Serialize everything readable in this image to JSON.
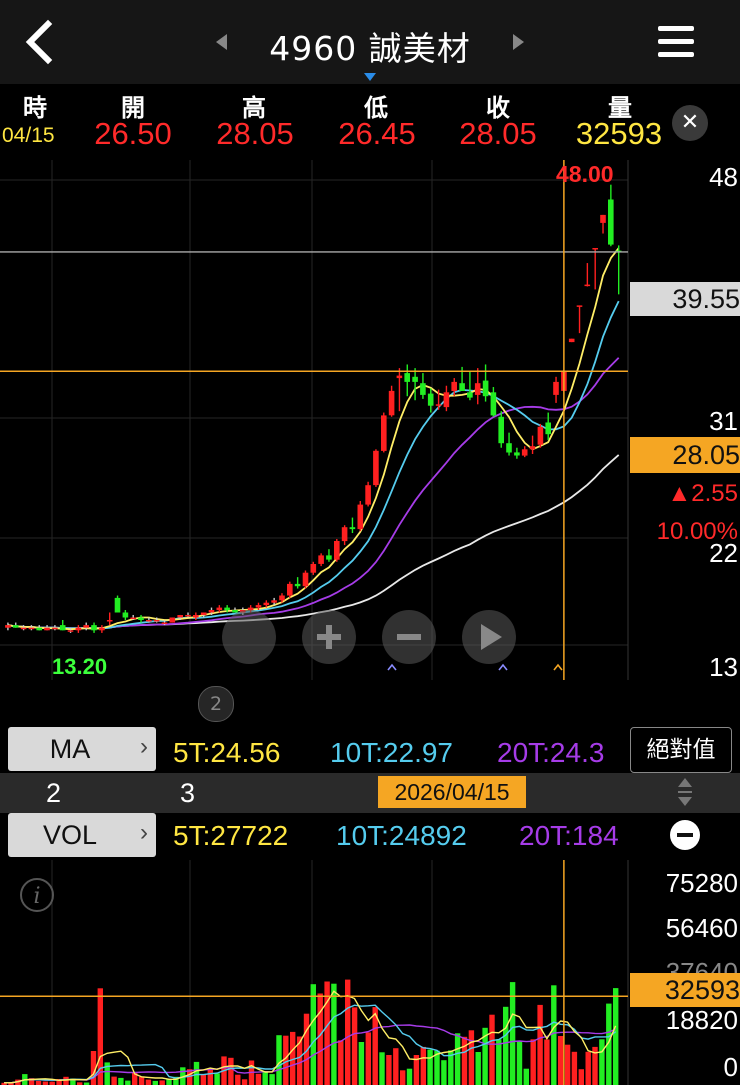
{
  "header": {
    "title": "4960 誠美材"
  },
  "quote": {
    "labels": [
      "時",
      "開",
      "高",
      "低",
      "收",
      "量"
    ],
    "date": "04/15",
    "open": "26.50",
    "high": "28.05",
    "low": "26.45",
    "close": "28.05",
    "volume": "32593"
  },
  "price_axis": {
    "labels": [
      "48",
      "31",
      "22",
      "13"
    ],
    "last_price": "39.55",
    "crosshair_price": "28.05",
    "change": "▲2.55",
    "change_pct": "10.00%",
    "max": "48.00",
    "min": "13.20"
  },
  "page_badge": "2",
  "ma_bar": {
    "button": "MA",
    "ma5": "5T:24.56",
    "ma10": "10T:22.97",
    "ma20": "20T:24.3",
    "abs_button": "絕對值"
  },
  "axis_bar": {
    "left_nums": [
      "2",
      "3"
    ],
    "date": "2026/04/15"
  },
  "vol_bar": {
    "button": "VOL",
    "v5": "5T:27722",
    "v10": "10T:24892",
    "v20": "20T:184"
  },
  "vol_axis": {
    "labels": [
      "75280",
      "56460",
      "37640",
      "18820",
      "0"
    ],
    "crosshair_vol": "32593"
  },
  "colors": {
    "up": "#ff2020",
    "down": "#22ee22",
    "ma5": "#ffee66",
    "ma10": "#55ccee",
    "ma20": "#a63ce8",
    "ma60": "#e8e8e8",
    "crosshair": "#f5a623"
  },
  "chart_data": {
    "type": "candlestick",
    "yscale": "log",
    "ylim": [
      12.0,
      49.5
    ],
    "candles": [
      {
        "o": 13.4,
        "h": 13.6,
        "l": 13.3,
        "c": 13.5
      },
      {
        "o": 13.5,
        "h": 13.6,
        "l": 13.4,
        "c": 13.4
      },
      {
        "o": 13.4,
        "h": 13.5,
        "l": 13.3,
        "c": 13.4
      },
      {
        "o": 13.4,
        "h": 13.5,
        "l": 13.3,
        "c": 13.4
      },
      {
        "o": 13.4,
        "h": 13.5,
        "l": 13.3,
        "c": 13.3
      },
      {
        "o": 13.3,
        "h": 13.5,
        "l": 13.3,
        "c": 13.4
      },
      {
        "o": 13.4,
        "h": 13.5,
        "l": 13.3,
        "c": 13.4
      },
      {
        "o": 13.5,
        "h": 13.7,
        "l": 13.3,
        "c": 13.3
      },
      {
        "o": 13.3,
        "h": 13.4,
        "l": 13.2,
        "c": 13.3
      },
      {
        "o": 13.3,
        "h": 13.5,
        "l": 13.2,
        "c": 13.4
      },
      {
        "o": 13.4,
        "h": 13.6,
        "l": 13.3,
        "c": 13.5
      },
      {
        "o": 13.5,
        "h": 13.6,
        "l": 13.2,
        "c": 13.3
      },
      {
        "o": 13.3,
        "h": 13.5,
        "l": 13.2,
        "c": 13.4
      },
      {
        "o": 13.7,
        "h": 14.0,
        "l": 13.5,
        "c": 13.7
      },
      {
        "o": 14.6,
        "h": 14.7,
        "l": 14.0,
        "c": 14.0
      },
      {
        "o": 14.0,
        "h": 14.1,
        "l": 13.7,
        "c": 13.8
      },
      {
        "o": 13.8,
        "h": 13.9,
        "l": 13.7,
        "c": 13.8
      },
      {
        "o": 13.8,
        "h": 13.9,
        "l": 13.6,
        "c": 13.7
      },
      {
        "o": 13.7,
        "h": 13.8,
        "l": 13.6,
        "c": 13.7
      },
      {
        "o": 13.7,
        "h": 13.8,
        "l": 13.6,
        "c": 13.7
      },
      {
        "o": 13.6,
        "h": 13.7,
        "l": 13.5,
        "c": 13.6
      },
      {
        "o": 13.6,
        "h": 13.8,
        "l": 13.6,
        "c": 13.8
      },
      {
        "o": 13.8,
        "h": 13.9,
        "l": 13.7,
        "c": 13.9
      },
      {
        "o": 13.9,
        "h": 14.0,
        "l": 13.8,
        "c": 13.9
      },
      {
        "o": 13.8,
        "h": 14.0,
        "l": 13.7,
        "c": 13.9
      },
      {
        "o": 13.9,
        "h": 14.0,
        "l": 13.8,
        "c": 14.0
      },
      {
        "o": 14.0,
        "h": 14.2,
        "l": 13.9,
        "c": 14.1
      },
      {
        "o": 14.1,
        "h": 14.3,
        "l": 14.0,
        "c": 14.2
      },
      {
        "o": 14.2,
        "h": 14.3,
        "l": 14.0,
        "c": 14.1
      },
      {
        "o": 14.1,
        "h": 14.2,
        "l": 14.0,
        "c": 14.0
      },
      {
        "o": 14.0,
        "h": 14.2,
        "l": 13.9,
        "c": 14.1
      },
      {
        "o": 14.1,
        "h": 14.3,
        "l": 14.0,
        "c": 14.2
      },
      {
        "o": 14.2,
        "h": 14.4,
        "l": 14.1,
        "c": 14.3
      },
      {
        "o": 14.3,
        "h": 14.5,
        "l": 14.2,
        "c": 14.4
      },
      {
        "o": 14.4,
        "h": 14.6,
        "l": 14.3,
        "c": 14.5
      },
      {
        "o": 14.5,
        "h": 14.8,
        "l": 14.4,
        "c": 14.7
      },
      {
        "o": 14.7,
        "h": 15.3,
        "l": 14.6,
        "c": 15.2
      },
      {
        "o": 15.2,
        "h": 15.5,
        "l": 15.0,
        "c": 15.1
      },
      {
        "o": 15.1,
        "h": 15.8,
        "l": 15.0,
        "c": 15.7
      },
      {
        "o": 15.7,
        "h": 16.2,
        "l": 15.6,
        "c": 16.1
      },
      {
        "o": 16.1,
        "h": 16.6,
        "l": 16.0,
        "c": 16.5
      },
      {
        "o": 16.5,
        "h": 16.8,
        "l": 16.2,
        "c": 16.3
      },
      {
        "o": 16.3,
        "h": 17.3,
        "l": 16.2,
        "c": 17.2
      },
      {
        "o": 17.2,
        "h": 18.0,
        "l": 17.0,
        "c": 17.9
      },
      {
        "o": 17.9,
        "h": 18.4,
        "l": 17.6,
        "c": 17.8
      },
      {
        "o": 17.8,
        "h": 19.3,
        "l": 17.7,
        "c": 19.1
      },
      {
        "o": 19.1,
        "h": 20.4,
        "l": 19.0,
        "c": 20.2
      },
      {
        "o": 20.2,
        "h": 22.4,
        "l": 20.1,
        "c": 22.3
      },
      {
        "o": 22.3,
        "h": 24.9,
        "l": 22.2,
        "c": 24.7
      },
      {
        "o": 24.7,
        "h": 26.9,
        "l": 24.6,
        "c": 26.5
      },
      {
        "o": 27.5,
        "h": 28.3,
        "l": 25.0,
        "c": 27.7
      },
      {
        "o": 27.9,
        "h": 28.6,
        "l": 26.1,
        "c": 27.2
      },
      {
        "o": 27.6,
        "h": 28.3,
        "l": 25.8,
        "c": 27.2
      },
      {
        "o": 27.1,
        "h": 27.9,
        "l": 25.9,
        "c": 26.2
      },
      {
        "o": 26.3,
        "h": 26.7,
        "l": 24.9,
        "c": 25.4
      },
      {
        "o": 25.5,
        "h": 26.6,
        "l": 25.1,
        "c": 25.5
      },
      {
        "o": 25.3,
        "h": 26.9,
        "l": 25.0,
        "c": 26.4
      },
      {
        "o": 26.5,
        "h": 27.5,
        "l": 26.1,
        "c": 27.2
      },
      {
        "o": 27.1,
        "h": 28.4,
        "l": 26.6,
        "c": 26.5
      },
      {
        "o": 26.4,
        "h": 28.0,
        "l": 25.8,
        "c": 26.0
      },
      {
        "o": 26.2,
        "h": 28.3,
        "l": 25.5,
        "c": 27.1
      },
      {
        "o": 27.3,
        "h": 28.6,
        "l": 25.7,
        "c": 26.1
      },
      {
        "o": 26.4,
        "h": 26.8,
        "l": 24.6,
        "c": 24.7
      },
      {
        "o": 24.6,
        "h": 25.0,
        "l": 22.5,
        "c": 22.8
      },
      {
        "o": 22.8,
        "h": 23.5,
        "l": 22.0,
        "c": 22.2
      },
      {
        "o": 22.2,
        "h": 22.5,
        "l": 21.8,
        "c": 22.0
      },
      {
        "o": 22.0,
        "h": 22.6,
        "l": 21.9,
        "c": 22.4
      },
      {
        "o": 22.4,
        "h": 23.3,
        "l": 22.1,
        "c": 22.6
      },
      {
        "o": 22.7,
        "h": 24.1,
        "l": 22.5,
        "c": 23.9
      },
      {
        "o": 24.2,
        "h": 24.9,
        "l": 23.0,
        "c": 23.4
      },
      {
        "o": 26.2,
        "h": 27.6,
        "l": 25.6,
        "c": 27.2
      },
      {
        "o": 26.5,
        "h": 28.05,
        "l": 26.45,
        "c": 28.05
      },
      {
        "o": 30.5,
        "h": 30.8,
        "l": 30.5,
        "c": 30.8
      },
      {
        "o": 33.9,
        "h": 33.9,
        "l": 31.3,
        "c": 33.9
      },
      {
        "o": 36.0,
        "h": 38.3,
        "l": 35.8,
        "c": 36.0
      },
      {
        "o": 40.0,
        "h": 40.0,
        "l": 35.5,
        "c": 40.0
      },
      {
        "o": 43.0,
        "h": 44.0,
        "l": 41.7,
        "c": 44.0
      },
      {
        "o": 46.0,
        "h": 48.0,
        "l": 40.2,
        "c": 40.4
      },
      {
        "o": 39.7,
        "h": 40.3,
        "l": 35.0,
        "c": 39.55
      }
    ],
    "volume": [
      800,
      800,
      2000,
      4000,
      2500,
      1500,
      1300,
      1200,
      2200,
      3000,
      2400,
      1000,
      900,
      12500,
      35500,
      8300,
      3100,
      2600,
      1600,
      4700,
      3000,
      2000,
      1500,
      1700,
      2200,
      3000,
      6500,
      5800,
      8500,
      4000,
      6200,
      4300,
      10500,
      10000,
      3800,
      2100,
      9000,
      4100,
      4800,
      4000,
      18300,
      18100,
      19500,
      17800,
      26200,
      37000,
      33600,
      38000,
      37200,
      16400,
      38700,
      28500,
      15800,
      19300,
      28600,
      12000,
      11000,
      13500,
      5400,
      6000,
      11000,
      14000,
      13000,
      12600,
      9100,
      12700,
      19000,
      17700,
      20100,
      12100,
      21000,
      25800,
      16800,
      28700,
      37800,
      16200,
      6000,
      16800,
      29400,
      16700,
      36600,
      18000,
      14800,
      12200,
      5800,
      12200,
      14000,
      16800,
      29900,
      35600
    ]
  }
}
